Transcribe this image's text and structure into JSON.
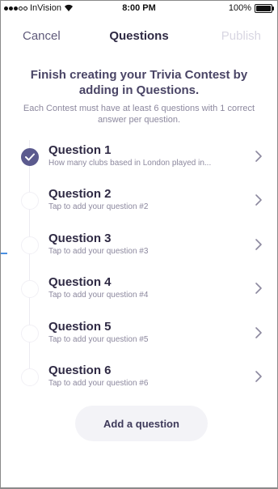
{
  "status_bar": {
    "carrier": "InVision",
    "time": "8:00 PM",
    "battery": "100%"
  },
  "nav": {
    "cancel_label": "Cancel",
    "title": "Questions",
    "publish_label": "Publish"
  },
  "intro": {
    "heading": "Finish creating your Trivia Contest by adding in Questions.",
    "subtext": "Each Contest must have at least 6 questions with 1 correct answer per question."
  },
  "questions": [
    {
      "title": "Question 1",
      "subtitle": "How many clubs based in London played in...",
      "completed": true
    },
    {
      "title": "Question 2",
      "subtitle": "Tap to add your question #2",
      "completed": false
    },
    {
      "title": "Question 3",
      "subtitle": "Tap to add your question #3",
      "completed": false
    },
    {
      "title": "Question 4",
      "subtitle": "Tap to add your question #4",
      "completed": false
    },
    {
      "title": "Question 5",
      "subtitle": "Tap to add your question #5",
      "completed": false
    },
    {
      "title": "Question 6",
      "subtitle": "Tap to add your question #6",
      "completed": false
    }
  ],
  "add_button_label": "Add a question",
  "colors": {
    "accent": "#5b5a8e",
    "title_text": "#2f2a44",
    "muted_text": "#8c889e",
    "disabled_text": "#d8d6e2",
    "button_bg": "#f3f3f7"
  }
}
